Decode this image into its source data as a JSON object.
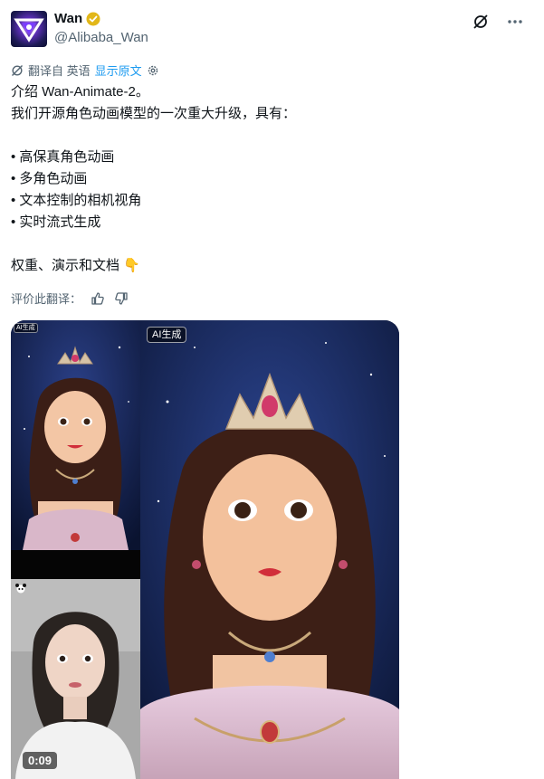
{
  "header": {
    "name": "Wan",
    "handle": "@Alibaba_Wan",
    "verified_color": "#e2b719"
  },
  "translate": {
    "translated_from": "翻译自 英语",
    "show_original": "显示原文"
  },
  "tweet": {
    "lines": [
      "介绍 Wan-Animate-2。",
      "我们开源角色动画模型的一次重大升级，具有：",
      "",
      "• 高保真角色动画",
      "• 多角色动画",
      "• 文本控制的相机视角",
      "• 实时流式生成",
      "",
      "权重、演示和文档 👇"
    ]
  },
  "rate": {
    "label": "评价此翻译："
  },
  "media": {
    "ai_badge_small": "AI生成",
    "ai_badge": "AI生成",
    "duration": "0:09"
  },
  "colors": {
    "link": "#1d9bf0",
    "muted": "#536471",
    "text": "#0f1419"
  }
}
